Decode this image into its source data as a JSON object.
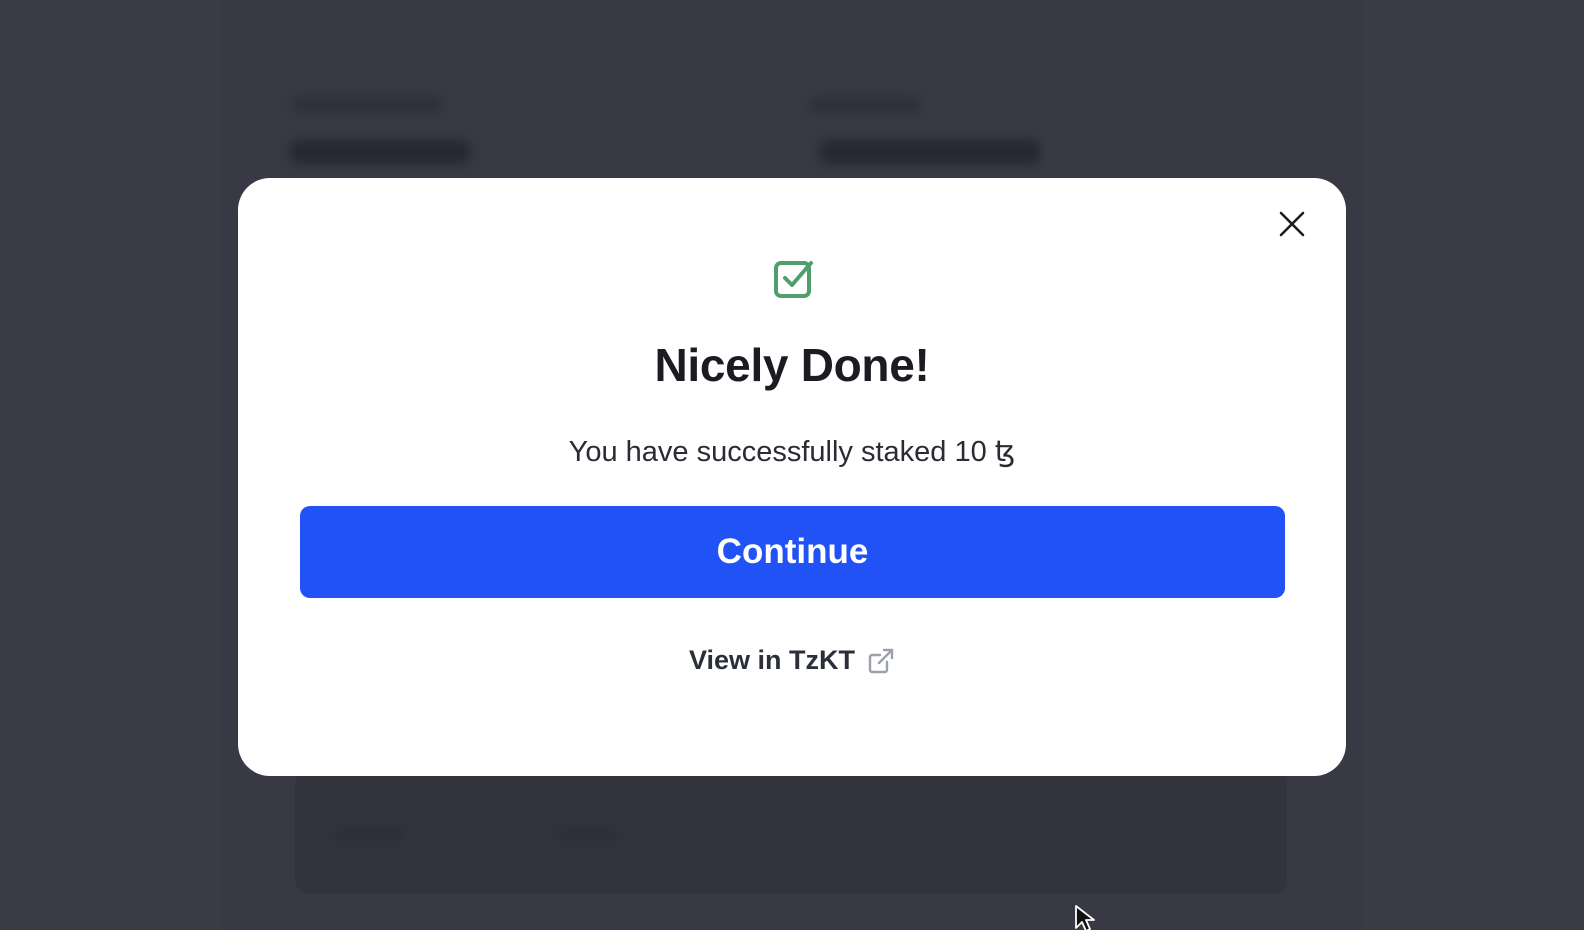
{
  "modal": {
    "title": "Nicely Done!",
    "message": "You have successfully staked 10 ꜩ",
    "continue_label": "Continue",
    "view_link_label": "View in TzKT",
    "success_icon": "check-square-icon",
    "close_icon": "close-icon",
    "external_icon": "external-link-icon"
  },
  "colors": {
    "accent": "#2152f5",
    "success": "#4f9e6e",
    "overlay": "#3a3b45"
  }
}
